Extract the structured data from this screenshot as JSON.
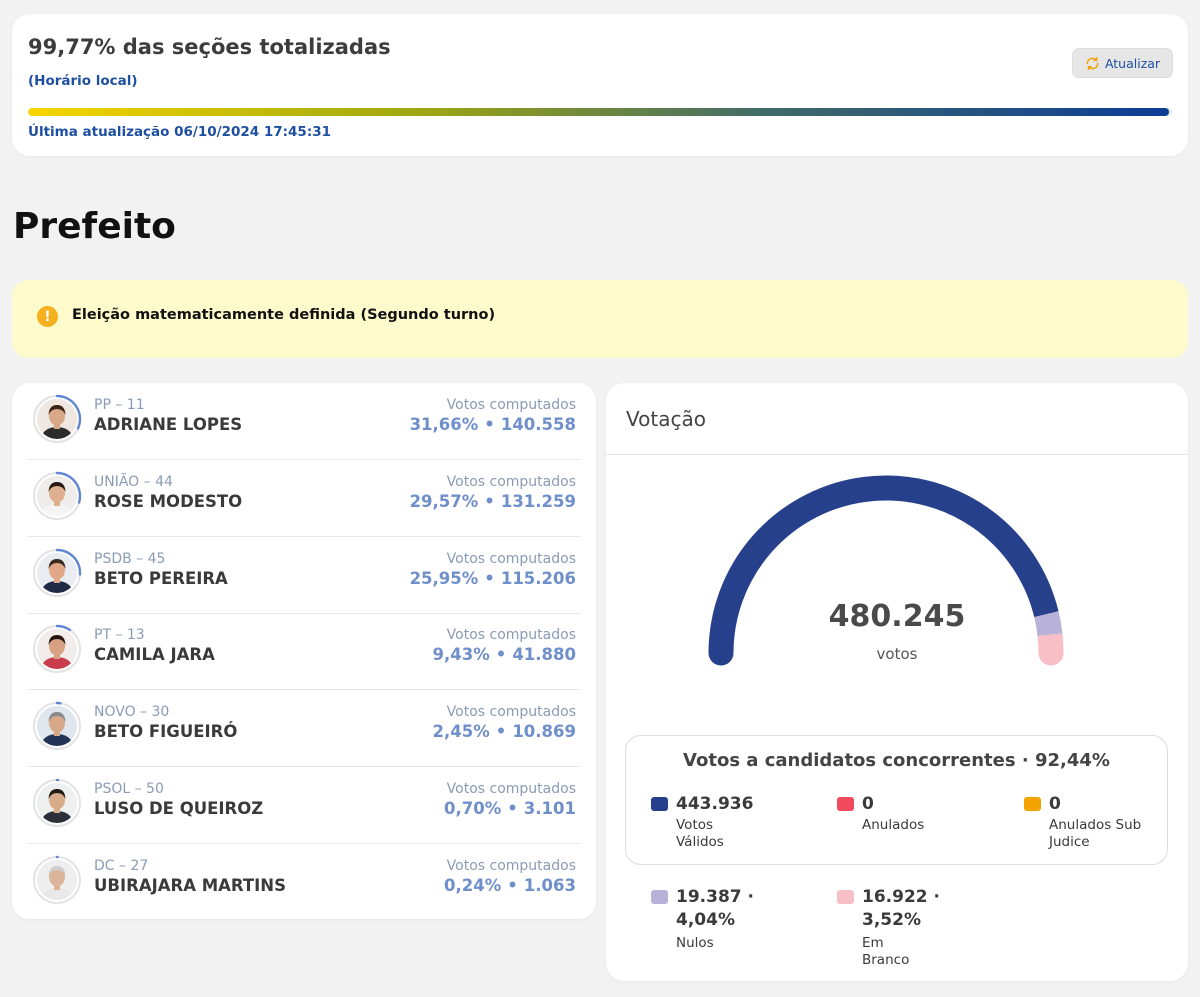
{
  "header": {
    "title": "99,77% das seções totalizadas",
    "subtitle": "(Horário local)",
    "refresh_label": "Atualizar",
    "progress": 0.9977,
    "last_update": "Última atualização 06/10/2024 17:45:31"
  },
  "section": {
    "title": "Prefeito"
  },
  "alert": {
    "icon": "info-icon",
    "text": "Eleição matematicamente definida (Segundo turno)"
  },
  "candidates": [
    {
      "party": "PP – 11",
      "name": "ADRIANE LOPES",
      "label": "Votos computados",
      "percent": "31,66%",
      "votes": "140.558",
      "share": 0.3166
    },
    {
      "party": "UNIÃO – 44",
      "name": "ROSE MODESTO",
      "label": "Votos computados",
      "percent": "29,57%",
      "votes": "131.259",
      "share": 0.2957
    },
    {
      "party": "PSDB – 45",
      "name": "BETO PEREIRA",
      "label": "Votos computados",
      "percent": "25,95%",
      "votes": "115.206",
      "share": 0.2595
    },
    {
      "party": "PT – 13",
      "name": "CAMILA JARA",
      "label": "Votos computados",
      "percent": "9,43%",
      "votes": "41.880",
      "share": 0.0943
    },
    {
      "party": "NOVO – 30",
      "name": "BETO FIGUEIRÓ",
      "label": "Votos computados",
      "percent": "2,45%",
      "votes": "10.869",
      "share": 0.0245
    },
    {
      "party": "PSOL – 50",
      "name": "LUSO DE QUEIROZ",
      "label": "Votos computados",
      "percent": "0,70%",
      "votes": "3.101",
      "share": 0.007
    },
    {
      "party": "DC – 27",
      "name": "UBIRAJARA MARTINS",
      "label": "Votos computados",
      "percent": "0,24%",
      "votes": "1.063",
      "share": 0.0024
    }
  ],
  "votacao": {
    "title": "Votação",
    "total": "480.245",
    "total_unit": "votos",
    "gauge_segments": [
      {
        "name": "Votos Válidos",
        "fraction": 0.9244,
        "color": "#27408b"
      },
      {
        "name": "Nulos",
        "fraction": 0.0404,
        "color": "#b8b2d9"
      },
      {
        "name": "Em Branco",
        "fraction": 0.0352,
        "color": "#f9bfc6"
      }
    ],
    "valid_box_title": "Votos a candidatos concorrentes · 92,44%",
    "stats": [
      {
        "value": "443.936",
        "label": "Votos Válidos",
        "color": "#27408b"
      },
      {
        "value": "0",
        "label": "Anulados",
        "color": "#f24a5e"
      },
      {
        "value": "0",
        "label": "Anulados Sub Judice",
        "color": "#f5a300"
      }
    ],
    "nulos": {
      "value_line1": "19.387 ·",
      "value_line2": "4,04%",
      "label": "Nulos",
      "color": "#b8b2d9"
    },
    "branco": {
      "value_line1": "16.922 ·",
      "value_line2": "3,52%",
      "label": "Em Branco",
      "color": "#f9bfc6"
    }
  }
}
